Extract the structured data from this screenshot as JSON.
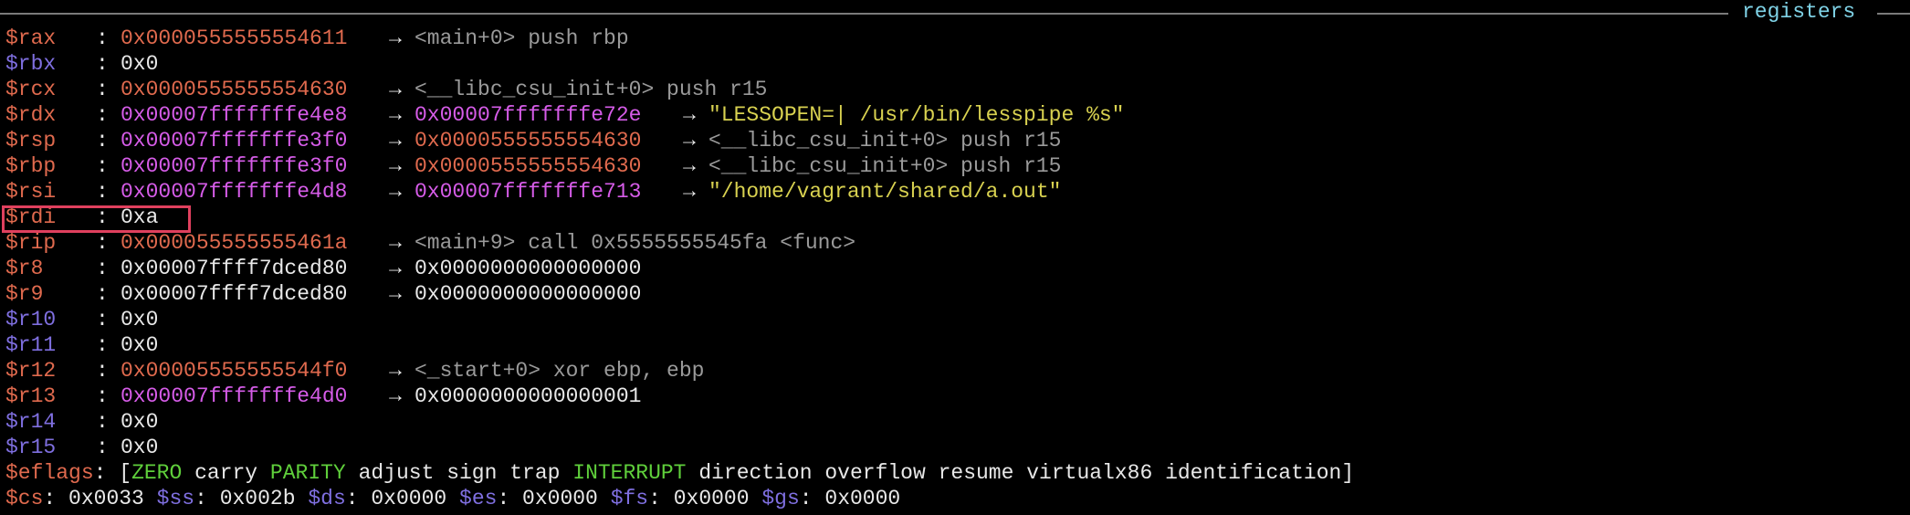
{
  "header": {
    "title": "registers"
  },
  "colors": {
    "register_changed": "#e06a4e",
    "register_unchanged": "#7f6fe0",
    "value_plain": "#e8e8e8",
    "value_code": "#e06a4e",
    "value_stack": "#d65ce8",
    "value_string": "#d8d150",
    "symbol": "#9a9a9a",
    "flag_set": "#5fcf3b",
    "highlight_box": "#e0405e",
    "header_title": "#7fd2e6"
  },
  "registers": [
    {
      "name": "$rax",
      "nc": "#e06a4e",
      "colon": ":",
      "value": "0x0000555555554611",
      "vc": "#e06a4e",
      "arrow": "→",
      "v2": "<main+0> push rbp",
      "v2c": "#9a9a9a",
      "arrow2": "",
      "v3": "",
      "v3c": "#9a9a9a"
    },
    {
      "name": "$rbx",
      "nc": "#7f6fe0",
      "colon": ":",
      "value": "0x0",
      "vc": "#e8e8e8",
      "arrow": "",
      "v2": "",
      "v2c": "#9a9a9a",
      "arrow2": "",
      "v3": "",
      "v3c": "#9a9a9a"
    },
    {
      "name": "$rcx",
      "nc": "#e06a4e",
      "colon": ":",
      "value": "0x0000555555554630",
      "vc": "#e06a4e",
      "arrow": "→",
      "v2": "<__libc_csu_init+0> push r15",
      "v2c": "#9a9a9a",
      "arrow2": "",
      "v3": "",
      "v3c": "#9a9a9a"
    },
    {
      "name": "$rdx",
      "nc": "#e06a4e",
      "colon": ":",
      "value": "0x00007fffffffe4e8",
      "vc": "#d65ce8",
      "arrow": "→",
      "v2": "0x00007fffffffe72e",
      "v2c": "#d65ce8",
      "arrow2": "→",
      "v3": "\"LESSOPEN=| /usr/bin/lesspipe %s\"",
      "v3c": "#d8d150"
    },
    {
      "name": "$rsp",
      "nc": "#e06a4e",
      "colon": ":",
      "value": "0x00007fffffffe3f0",
      "vc": "#d65ce8",
      "arrow": "→",
      "v2": "0x0000555555554630",
      "v2c": "#e06a4e",
      "arrow2": "→",
      "v3": "<__libc_csu_init+0> push r15",
      "v3c": "#9a9a9a"
    },
    {
      "name": "$rbp",
      "nc": "#e06a4e",
      "colon": ":",
      "value": "0x00007fffffffe3f0",
      "vc": "#d65ce8",
      "arrow": "→",
      "v2": "0x0000555555554630",
      "v2c": "#e06a4e",
      "arrow2": "→",
      "v3": "<__libc_csu_init+0> push r15",
      "v3c": "#9a9a9a"
    },
    {
      "name": "$rsi",
      "nc": "#e06a4e",
      "colon": ":",
      "value": "0x00007fffffffe4d8",
      "vc": "#d65ce8",
      "arrow": "→",
      "v2": "0x00007fffffffe713",
      "v2c": "#d65ce8",
      "arrow2": "→",
      "v3": "\"/home/vagrant/shared/a.out\"",
      "v3c": "#d8d150"
    },
    {
      "name": "$rdi",
      "nc": "#e06a4e",
      "colon": ":",
      "value": "0xa",
      "vc": "#e8e8e8",
      "arrow": "",
      "v2": "",
      "v2c": "#9a9a9a",
      "arrow2": "",
      "v3": "",
      "v3c": "#9a9a9a"
    },
    {
      "name": "$rip",
      "nc": "#e06a4e",
      "colon": ":",
      "value": "0x000055555555461a",
      "vc": "#e06a4e",
      "arrow": "→",
      "v2": "<main+9> call 0x5555555545fa <func>",
      "v2c": "#9a9a9a",
      "arrow2": "",
      "v3": "",
      "v3c": "#9a9a9a"
    },
    {
      "name": "$r8",
      "nc": "#e06a4e",
      "colon": ":",
      "value": "0x00007ffff7dced80",
      "vc": "#e8e8e8",
      "arrow": "→",
      "v2": "0x0000000000000000",
      "v2c": "#e8e8e8",
      "arrow2": "",
      "v3": "",
      "v3c": "#9a9a9a"
    },
    {
      "name": "$r9",
      "nc": "#e06a4e",
      "colon": ":",
      "value": "0x00007ffff7dced80",
      "vc": "#e8e8e8",
      "arrow": "→",
      "v2": "0x0000000000000000",
      "v2c": "#e8e8e8",
      "arrow2": "",
      "v3": "",
      "v3c": "#9a9a9a"
    },
    {
      "name": "$r10",
      "nc": "#7f6fe0",
      "colon": ":",
      "value": "0x0",
      "vc": "#e8e8e8",
      "arrow": "",
      "v2": "",
      "v2c": "#9a9a9a",
      "arrow2": "",
      "v3": "",
      "v3c": "#9a9a9a"
    },
    {
      "name": "$r11",
      "nc": "#7f6fe0",
      "colon": ":",
      "value": "0x0",
      "vc": "#e8e8e8",
      "arrow": "",
      "v2": "",
      "v2c": "#9a9a9a",
      "arrow2": "",
      "v3": "",
      "v3c": "#9a9a9a"
    },
    {
      "name": "$r12",
      "nc": "#e06a4e",
      "colon": ":",
      "value": "0x00005555555544f0",
      "vc": "#e06a4e",
      "arrow": "→",
      "v2": "<_start+0> xor ebp, ebp",
      "v2c": "#9a9a9a",
      "arrow2": "",
      "v3": "",
      "v3c": "#9a9a9a"
    },
    {
      "name": "$r13",
      "nc": "#e06a4e",
      "colon": ":",
      "value": "0x00007fffffffe4d0",
      "vc": "#d65ce8",
      "arrow": "→",
      "v2": "0x0000000000000001",
      "v2c": "#e8e8e8",
      "arrow2": "",
      "v3": "",
      "v3c": "#9a9a9a"
    },
    {
      "name": "$r14",
      "nc": "#7f6fe0",
      "colon": ":",
      "value": "0x0",
      "vc": "#e8e8e8",
      "arrow": "",
      "v2": "",
      "v2c": "#9a9a9a",
      "arrow2": "",
      "v3": "",
      "v3c": "#9a9a9a"
    },
    {
      "name": "$r15",
      "nc": "#7f6fe0",
      "colon": ":",
      "value": "0x0",
      "vc": "#e8e8e8",
      "arrow": "",
      "v2": "",
      "v2c": "#9a9a9a",
      "arrow2": "",
      "v3": "",
      "v3c": "#9a9a9a"
    }
  ],
  "eflags": {
    "name": "$eflags",
    "colon": ":",
    "open": "[",
    "close": "]",
    "flags": [
      {
        "label": "ZERO",
        "set": true
      },
      {
        "label": "carry",
        "set": false
      },
      {
        "label": "PARITY",
        "set": true
      },
      {
        "label": "adjust",
        "set": false
      },
      {
        "label": "sign",
        "set": false
      },
      {
        "label": "trap",
        "set": false
      },
      {
        "label": "INTERRUPT",
        "set": true
      },
      {
        "label": "direction",
        "set": false
      },
      {
        "label": "overflow",
        "set": false
      },
      {
        "label": "resume",
        "set": false
      },
      {
        "label": "virtualx86",
        "set": false
      },
      {
        "label": "identification",
        "set": false
      }
    ]
  },
  "segments": [
    {
      "name": "$cs",
      "nc": "#e06a4e",
      "value": "0x0033"
    },
    {
      "name": "$ss",
      "nc": "#7f6fe0",
      "value": "0x002b"
    },
    {
      "name": "$ds",
      "nc": "#7f6fe0",
      "value": "0x0000"
    },
    {
      "name": "$es",
      "nc": "#7f6fe0",
      "value": "0x0000"
    },
    {
      "name": "$fs",
      "nc": "#7f6fe0",
      "value": "0x0000"
    },
    {
      "name": "$gs",
      "nc": "#7f6fe0",
      "value": "0x0000"
    }
  ]
}
